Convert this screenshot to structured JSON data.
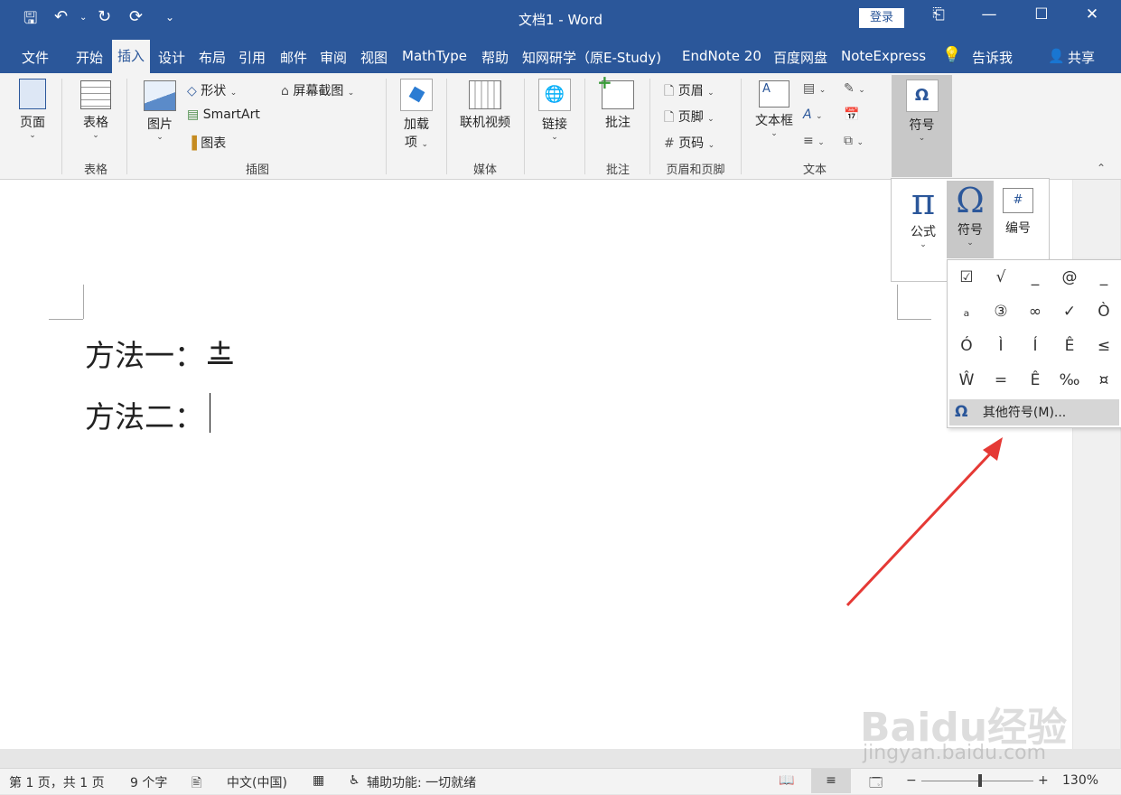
{
  "window": {
    "title": "文档1  -  Word",
    "login_label": "登录"
  },
  "tabs": [
    {
      "label": "文件"
    },
    {
      "label": "开始"
    },
    {
      "label": "插入"
    },
    {
      "label": "设计"
    },
    {
      "label": "布局"
    },
    {
      "label": "引用"
    },
    {
      "label": "邮件"
    },
    {
      "label": "审阅"
    },
    {
      "label": "视图"
    },
    {
      "label": "MathType"
    },
    {
      "label": "帮助"
    },
    {
      "label": "知网研学（原E-Study)"
    },
    {
      "label": "EndNote 20"
    },
    {
      "label": "百度网盘"
    },
    {
      "label": "NoteExpress"
    },
    {
      "label": "告诉我"
    },
    {
      "label": "共享"
    }
  ],
  "ribbon": {
    "pages": {
      "button": "页面"
    },
    "tables": {
      "button": "表格",
      "group": "表格"
    },
    "illustrations": {
      "picture": "图片",
      "shapes": "形状",
      "smartart": "SmartArt",
      "chart": "图表",
      "screenshot": "屏幕截图",
      "group": "插图"
    },
    "addins": {
      "button_line1": "加载",
      "button_line2": "项"
    },
    "media": {
      "button": "联机视频",
      "group": "媒体"
    },
    "links": {
      "button": "链接"
    },
    "comments": {
      "button": "批注",
      "group": "批注"
    },
    "header_footer": {
      "header": "页眉",
      "footer": "页脚",
      "page_number": "页码",
      "group": "页眉和页脚"
    },
    "text": {
      "textbox": "文本框",
      "group": "文本"
    },
    "symbols": {
      "button": "符号"
    }
  },
  "symbols_menu": {
    "equation": "公式",
    "symbol": "符号",
    "number": "编号",
    "grid": [
      "☑",
      "√",
      "_",
      "@",
      "_",
      "ₐ",
      "③",
      "∞",
      "✓",
      "Ò",
      "Ó",
      "Ì",
      "Í",
      "Ê",
      "≤",
      "Ŵ",
      "=",
      "Ê",
      "‰",
      "¤"
    ],
    "more_symbols": "其他符号(M)..."
  },
  "document": {
    "line1_label": "方法一：",
    "line1_value": "±",
    "line2_label": "方法二："
  },
  "statusbar": {
    "page": "第 1 页，共 1 页",
    "words": "9 个字",
    "language": "中文(中国)",
    "accessibility": "辅助功能: 一切就绪",
    "zoom": "130%"
  },
  "watermark": {
    "text": "Baidu经验",
    "url": "jingyan.baidu.com"
  }
}
